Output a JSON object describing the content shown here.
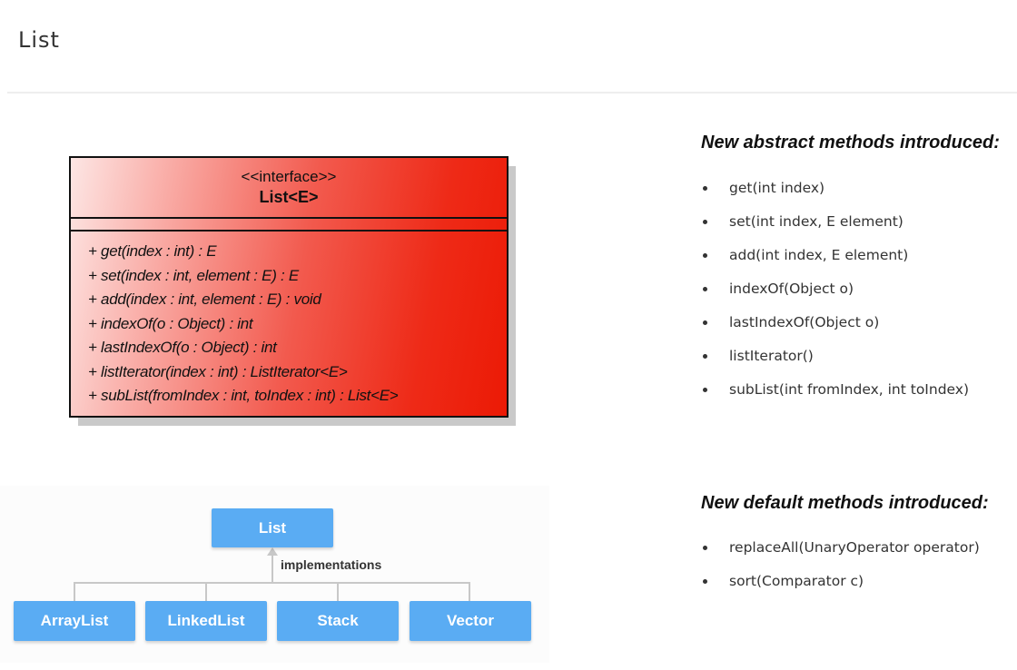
{
  "page": {
    "title": "List"
  },
  "uml": {
    "stereotype": "<<interface>>",
    "class_name": "List<E>",
    "methods": [
      "+ get(index : int) : E",
      "+ set(index : int, element : E) : E",
      "+ add(index : int, element : E) : void",
      "+ indexOf(o : Object) : int",
      "+ lastIndexOf(o : Object) : int",
      "+ listIterator(index : int) : ListIterator<E>",
      "+ subList(fromIndex : int, toIndex : int) : List<E>"
    ],
    "colors": {
      "fill_start": "#fde6e4",
      "fill_end": "#ec1a05",
      "border": "#111111"
    }
  },
  "tree": {
    "root": "List",
    "edge_label": "implementations",
    "children": [
      "ArrayList",
      "LinkedList",
      "Stack",
      "Vector"
    ],
    "colors": {
      "node": "#5aacf3",
      "connector": "#c8c8c8"
    }
  },
  "abstract_methods": {
    "heading": "New abstract methods introduced:",
    "items": [
      "get(int index)",
      "set(int index, E element)",
      "add(int index, E element)",
      "indexOf(Object o)",
      "lastIndexOf(Object o)",
      "listIterator()",
      "subList(int fromIndex, int toIndex)"
    ]
  },
  "default_methods": {
    "heading": "New default methods introduced:",
    "items": [
      "replaceAll(UnaryOperator operator)",
      "sort(Comparator c)"
    ]
  }
}
